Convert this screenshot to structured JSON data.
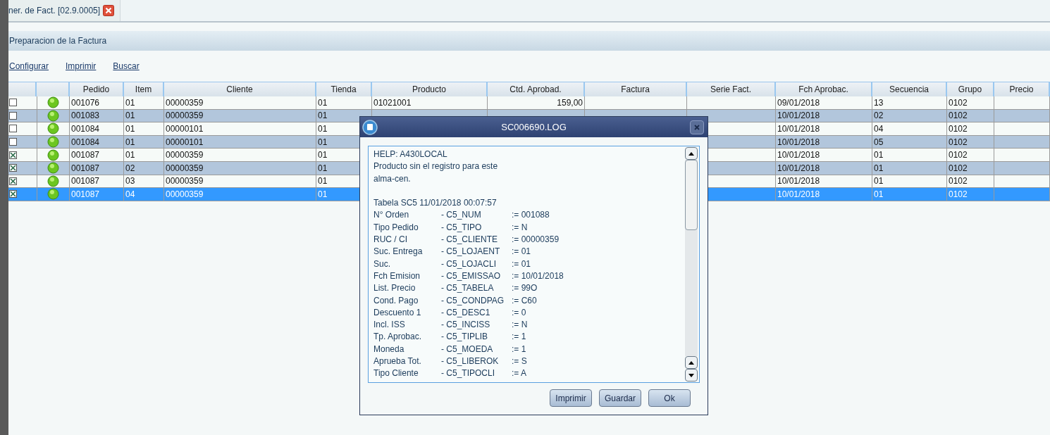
{
  "tab": {
    "title": "ner. de Fact. [02.9.0005]"
  },
  "panel_title": "Preparacion de la Factura",
  "actions": [
    "Configurar",
    "Imprimir",
    "Buscar"
  ],
  "table": {
    "columns": [
      "Pedido",
      "Item",
      "Cliente",
      "Tienda",
      "Producto",
      "Ctd. Aprobad.",
      "Factura",
      "Serie Fact.",
      "Fch Aprobac.",
      "Secuencia",
      "Grupo",
      "Precio"
    ],
    "rows": [
      {
        "checked": false,
        "selected": false,
        "cells": [
          "001076",
          "01",
          "00000359",
          "01",
          "01021001",
          "159,00",
          "",
          "",
          "09/01/2018",
          "13",
          "0102",
          ""
        ]
      },
      {
        "checked": false,
        "selected": false,
        "cells": [
          "001083",
          "01",
          "00000359",
          "01",
          "",
          "",
          "",
          "",
          "10/01/2018",
          "02",
          "0102",
          ""
        ]
      },
      {
        "checked": false,
        "selected": false,
        "cells": [
          "001084",
          "01",
          "00000101",
          "01",
          "",
          "",
          "",
          "",
          "10/01/2018",
          "04",
          "0102",
          ""
        ]
      },
      {
        "checked": false,
        "selected": false,
        "cells": [
          "001084",
          "01",
          "00000101",
          "01",
          "",
          "",
          "",
          "",
          "10/01/2018",
          "05",
          "0102",
          ""
        ]
      },
      {
        "checked": true,
        "selected": false,
        "cells": [
          "001087",
          "01",
          "00000359",
          "01",
          "",
          "",
          "",
          "",
          "10/01/2018",
          "01",
          "0102",
          ""
        ]
      },
      {
        "checked": true,
        "selected": false,
        "cells": [
          "001087",
          "02",
          "00000359",
          "01",
          "",
          "",
          "",
          "",
          "10/01/2018",
          "01",
          "0102",
          ""
        ]
      },
      {
        "checked": true,
        "selected": false,
        "cells": [
          "001087",
          "03",
          "00000359",
          "01",
          "",
          "",
          "",
          "",
          "10/01/2018",
          "01",
          "0102",
          ""
        ]
      },
      {
        "checked": true,
        "selected": true,
        "cells": [
          "001087",
          "04",
          "00000359",
          "01",
          "",
          "",
          "",
          "",
          "10/01/2018",
          "01",
          "0102",
          ""
        ]
      }
    ]
  },
  "dialog": {
    "title": "SC006690.LOG",
    "help_lines": [
      "HELP: A430LOCAL",
      "Producto sin el registro para este",
      "alma-cen."
    ],
    "table_line": "Tabela SC5 11/01/2018 00:07:57",
    "fields": [
      {
        "label": "N° Orden",
        "field": "- C5_NUM",
        "value": ":= 001088"
      },
      {
        "label": "Tipo Pedido",
        "field": "- C5_TIPO",
        "value": ":= N"
      },
      {
        "label": "RUC / CI",
        "field": "- C5_CLIENTE",
        "value": ":= 00000359"
      },
      {
        "label": "Suc. Entrega",
        "field": "- C5_LOJAENT",
        "value": ":= 01"
      },
      {
        "label": "Suc.",
        "field": "- C5_LOJACLI",
        "value": ":= 01"
      },
      {
        "label": "Fch Emision",
        "field": "- C5_EMISSAO",
        "value": ":= 10/01/2018"
      },
      {
        "label": "List. Precio",
        "field": "- C5_TABELA",
        "value": ":= 99O"
      },
      {
        "label": "Cond. Pago",
        "field": "- C5_CONDPAG",
        "value": ":= C60"
      },
      {
        "label": "Descuento 1",
        "field": "- C5_DESC1",
        "value": ":= 0"
      },
      {
        "label": "Incl. ISS",
        "field": "- C5_INCISS",
        "value": ":= N"
      },
      {
        "label": "Tp. Aprobac.",
        "field": "- C5_TIPLIB",
        "value": ":= 1"
      },
      {
        "label": "Moneda",
        "field": "- C5_MOEDA",
        "value": ":= 1"
      },
      {
        "label": "Aprueba Tot.",
        "field": "- C5_LIBEROK",
        "value": ":= S"
      },
      {
        "label": "Tipo Cliente",
        "field": "- C5_TIPOCLI",
        "value": ":= A"
      }
    ],
    "buttons": [
      "Imprimir",
      "Guardar",
      "Ok"
    ]
  }
}
